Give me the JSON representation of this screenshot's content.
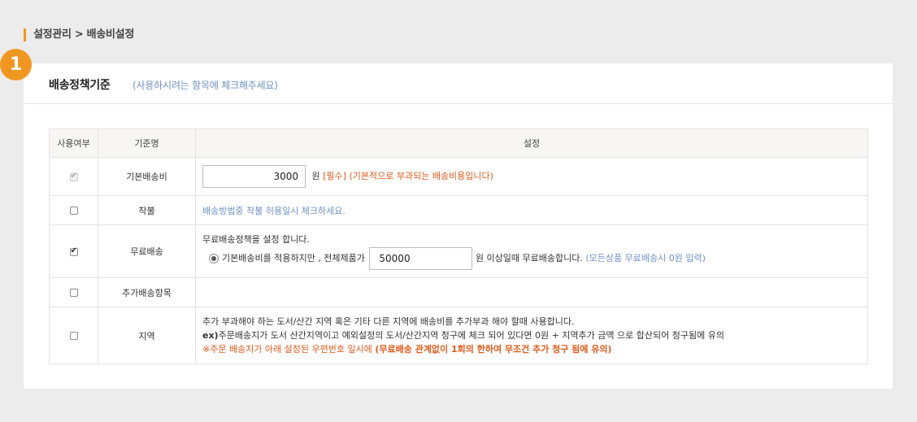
{
  "breadcrumb": "설정관리 > 배송비설정",
  "step_badge": "1",
  "panel": {
    "title": "배송정책기준",
    "hint": "(사용하시려는 항목에 체크해주세요)"
  },
  "table": {
    "headers": [
      "사용여부",
      "기준명",
      "설정"
    ],
    "rows": {
      "base_fee": {
        "name": "기본배송비",
        "checked": true,
        "disabled": true,
        "value": "3000",
        "unit": "원",
        "required": "[필수]",
        "note": "(기본적으로 부과되는 배송비용입니다)"
      },
      "cod": {
        "name": "착불",
        "checked": false,
        "note": "배송방법중 착불 허용일시 체크하세요."
      },
      "free": {
        "name": "무료배송",
        "checked": true,
        "title": "무료배송정책을 설정 합니다.",
        "radio_label": "기본배송비를 적용하지만 , 전체제품가",
        "value": "50000",
        "suffix": "원 이상일때 무료배송합니다.",
        "note": "(모든상품 무료배송시 0원 입력)"
      },
      "extra": {
        "name": "추가배송항목",
        "checked": false
      },
      "region": {
        "name": "지역",
        "checked": false,
        "line1": "추가 부과해야 하는 도서/산간 지역 혹은 기타 다른 지역에 배송비를 추가부과 해야 할때 사용합니다.",
        "line2_prefix": "ex)",
        "line2": "주문배송지가 도서 산간지역이고 예외설정의 도서/산간지역 청구에 체크 되어 있다면 0원 + 지역추가 금액 으로 합산되어 청구됨에 유의",
        "line3_warning": "※주문 배송지가 아래 설정된 우편번호 일시에",
        "line3_bold": "(무료배송 관계없이 1회의 한하여 무조건 추가 청구 됨에 유의)"
      }
    }
  },
  "colors": {
    "accent": "#f09722",
    "note_blue": "#6d91c7",
    "warning_orange": "#e05a1a"
  }
}
